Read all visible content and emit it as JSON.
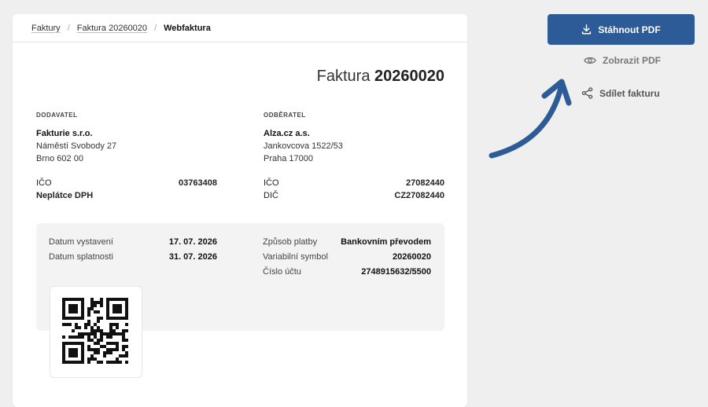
{
  "breadcrumb": {
    "items": [
      "Faktury",
      "Faktura 20260020"
    ],
    "current": "Webfaktura"
  },
  "invoice": {
    "title_prefix": "Faktura",
    "number": "20260020"
  },
  "supplier": {
    "role": "DODAVATEL",
    "name": "Fakturie s.r.o.",
    "street": "Náměstí Svobody 27",
    "city": "Brno 602 00",
    "ico_label": "IČO",
    "ico_value": "03763408",
    "vat_status": "Neplátce DPH"
  },
  "customer": {
    "role": "ODBĚRATEL",
    "name": "Alza.cz a.s.",
    "street": "Jankovcova 1522/53",
    "city": "Praha 17000",
    "ico_label": "IČO",
    "ico_value": "27082440",
    "dic_label": "DIČ",
    "dic_value": "CZ27082440"
  },
  "dates": {
    "issued_label": "Datum vystavení",
    "issued_value": "17. 07. 2026",
    "due_label": "Datum splatnosti",
    "due_value": "31. 07. 2026"
  },
  "payment": {
    "method_label": "Způsob platby",
    "method_value": "Bankovním převodem",
    "vs_label": "Variabilní symbol",
    "vs_value": "20260020",
    "account_label": "Číslo účtu",
    "account_value": "2748915632/5500"
  },
  "actions": {
    "download_label": "Stáhnout PDF",
    "view_label": "Zobrazit PDF",
    "share_label": "Sdílet fakturu",
    "download_icon": "download-icon",
    "view_icon": "eye-icon",
    "share_icon": "share-icon"
  },
  "colors": {
    "primary": "#2d5b97",
    "arrow": "#2d5b97"
  }
}
